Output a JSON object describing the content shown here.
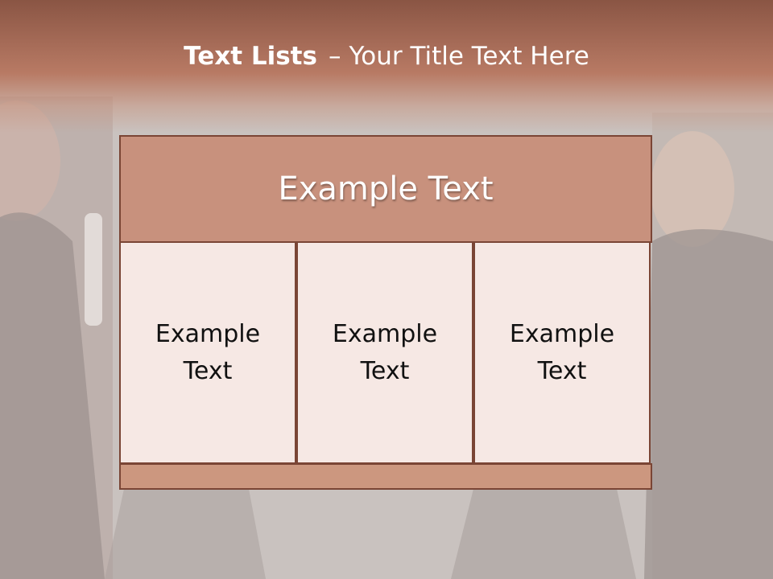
{
  "slide": {
    "title_bold": "Text Lists",
    "title_dash": "–",
    "title_rest": "Your Title Text Here"
  },
  "diagram": {
    "header_text": "Example Text",
    "columns": [
      {
        "line1": "Example",
        "line2": "Text"
      },
      {
        "line1": "Example",
        "line2": "Text"
      },
      {
        "line1": "Example",
        "line2": "Text"
      }
    ]
  },
  "colors": {
    "header_band": "#b87a64",
    "header_box": "#c8917d",
    "cell_fill": "#f6e8e4",
    "border": "#7a4535",
    "bottom_bar": "#cc977f"
  }
}
